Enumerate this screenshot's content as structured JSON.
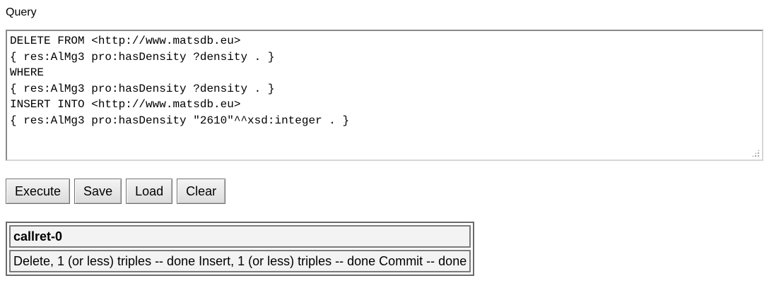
{
  "query_label": "Query",
  "query_lines": [
    "DELETE FROM <http://www.matsdb.eu>",
    "{ res:AlMg3 pro:hasDensity ?density . }",
    "WHERE",
    "{ res:AlMg3 pro:hasDensity ?density . }",
    "INSERT INTO <http://www.matsdb.eu>",
    "{ res:AlMg3 pro:hasDensity \"2610\"^^xsd:integer . }"
  ],
  "buttons": {
    "execute": "Execute",
    "save": "Save",
    "load": "Load",
    "clear": "Clear"
  },
  "result": {
    "header": "callret-0",
    "value": "Delete, 1 (or less) triples -- done Insert, 1 (or less) triples -- done Commit -- done"
  }
}
